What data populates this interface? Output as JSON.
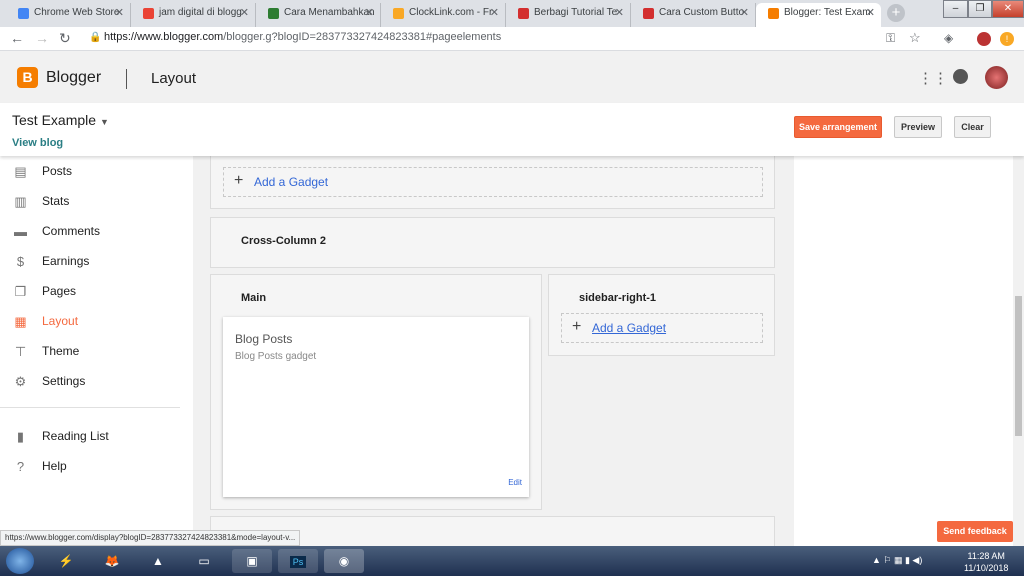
{
  "browser": {
    "tabs": [
      {
        "title": "Chrome Web Store",
        "icon": "chrome-web-store-icon",
        "color": "#4285f4"
      },
      {
        "title": "jam digital di blogg",
        "icon": "google-icon",
        "color": "#ea4335"
      },
      {
        "title": "Cara Menambahkan",
        "icon": "s-site-icon",
        "color": "#2e7d32"
      },
      {
        "title": "ClockLink.com - Fr",
        "icon": "clock-icon",
        "color": "#f9a825"
      },
      {
        "title": "Berbagi Tutorial Te",
        "icon": "site-icon",
        "color": "#d32f2f"
      },
      {
        "title": "Cara Custom Butto",
        "icon": "site-icon",
        "color": "#d32f2f"
      },
      {
        "title": "Blogger: Test Exam",
        "icon": "blogger-icon",
        "color": "#f57d00"
      }
    ],
    "url_host": "https://www.blogger.com",
    "url_path": "/blogger.g?blogID=283773327424823381#pageelements"
  },
  "app": {
    "logo_letter": "B",
    "name": "Blogger",
    "page_title": "Layout",
    "accent": "#f4693f"
  },
  "subheader": {
    "blog_name": "Test Example",
    "view_blog": "View blog",
    "save_label": "Save arrangement",
    "preview_label": "Preview",
    "clear_label": "Clear"
  },
  "sidebar": {
    "items": [
      {
        "label": "Posts",
        "icon": "posts-icon",
        "glyph": "▤"
      },
      {
        "label": "Stats",
        "icon": "stats-icon",
        "glyph": "▥"
      },
      {
        "label": "Comments",
        "icon": "comments-icon",
        "glyph": "▬"
      },
      {
        "label": "Earnings",
        "icon": "dollar-icon",
        "glyph": "$"
      },
      {
        "label": "Pages",
        "icon": "pages-icon",
        "glyph": "❐"
      },
      {
        "label": "Layout",
        "icon": "layout-icon",
        "glyph": "▦"
      },
      {
        "label": "Theme",
        "icon": "theme-icon",
        "glyph": "⊤"
      },
      {
        "label": "Settings",
        "icon": "gear-icon",
        "glyph": "⚙"
      }
    ],
    "extra_items": [
      {
        "label": "Reading List",
        "icon": "bookmark-icon",
        "glyph": "▮"
      },
      {
        "label": "Help",
        "icon": "help-icon",
        "glyph": "?"
      }
    ]
  },
  "layout": {
    "add_gadget": "Add a Gadget",
    "cross_column_2": "Cross-Column 2",
    "main_title": "Main",
    "sidebar_title": "sidebar-right-1",
    "gadget_title": "Blog Posts",
    "gadget_subtitle": "Blog Posts gadget",
    "gadget_edit": "Edit"
  },
  "feedback": "Send feedback",
  "status_link": "https://www.blogger.com/display?blogID=283773327424823381&mode=layout-v...",
  "taskbar": {
    "time": "11:28 AM",
    "date": "11/10/2018"
  }
}
